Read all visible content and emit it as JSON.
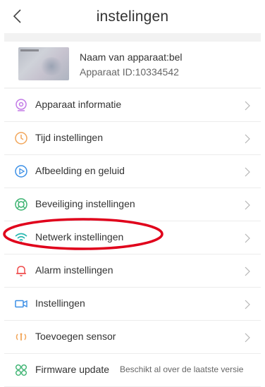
{
  "header": {
    "title": "instelingen"
  },
  "device": {
    "name_line": "Naam van apparaat:bel",
    "id_line": "Apparaat ID:10334542"
  },
  "menu": {
    "items": [
      {
        "label": "Apparaat informatie",
        "icon": "camera-icon",
        "color": "#c27ae6"
      },
      {
        "label": "Tijd instellingen",
        "icon": "clock-icon",
        "color": "#f2a65a"
      },
      {
        "label": "Afbeelding en geluid",
        "icon": "play-circle-icon",
        "color": "#3b8fe6"
      },
      {
        "label": "Beveiliging instellingen",
        "icon": "lifebuoy-icon",
        "color": "#3cb371"
      },
      {
        "label": "Netwerk instellingen",
        "icon": "wifi-icon",
        "color": "#28b8b0"
      },
      {
        "label": "Alarm instellingen",
        "icon": "bell-icon",
        "color": "#ef4b4b"
      },
      {
        "label": "Instellingen",
        "icon": "video-camera-icon",
        "color": "#3b8fe6"
      },
      {
        "label": "Toevoegen sensor",
        "icon": "signal-sensor-icon",
        "color": "#f2a65a"
      }
    ],
    "firmware": {
      "label": "Firmware update",
      "status": "Beschikt al over de laatste versie",
      "icon": "firmware-icon",
      "color": "#3cb371"
    }
  },
  "annotation": {
    "highlight_color": "#e0001b"
  }
}
